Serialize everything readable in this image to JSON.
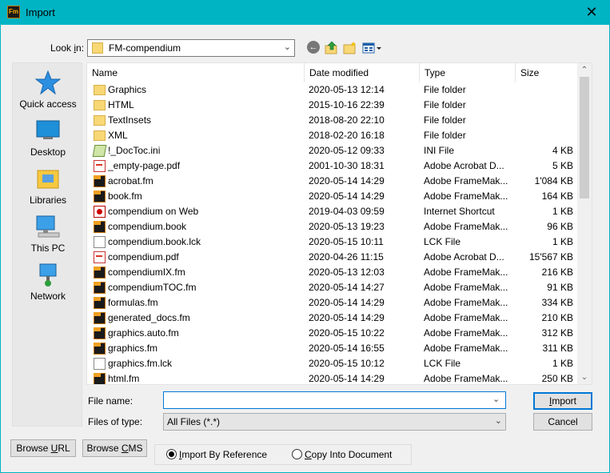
{
  "window": {
    "title": "Import",
    "app_icon": "Fm"
  },
  "lookin": {
    "label": "Look in:",
    "value": "FM-compendium"
  },
  "places": [
    {
      "label": "Quick access",
      "icon": "star-icon"
    },
    {
      "label": "Desktop",
      "icon": "desktop-icon"
    },
    {
      "label": "Libraries",
      "icon": "libraries-icon"
    },
    {
      "label": "This PC",
      "icon": "computer-icon"
    },
    {
      "label": "Network",
      "icon": "network-icon"
    }
  ],
  "columns": {
    "name": "Name",
    "date": "Date modified",
    "type": "Type",
    "size": "Size"
  },
  "files": [
    {
      "name": "Graphics",
      "date": "2020-05-13 12:14",
      "type": "File folder",
      "size": "",
      "icon": "folder"
    },
    {
      "name": "HTML",
      "date": "2015-10-16 22:39",
      "type": "File folder",
      "size": "",
      "icon": "folder"
    },
    {
      "name": "TextInsets",
      "date": "2018-08-20 22:10",
      "type": "File folder",
      "size": "",
      "icon": "folder"
    },
    {
      "name": "XML",
      "date": "2018-02-20 16:18",
      "type": "File folder",
      "size": "",
      "icon": "folder"
    },
    {
      "name": "!_DocToc.ini",
      "date": "2020-05-12 09:33",
      "type": "INI File",
      "size": "4 KB",
      "icon": "ini"
    },
    {
      "name": "_empty-page.pdf",
      "date": "2001-10-30 18:31",
      "type": "Adobe Acrobat D...",
      "size": "5 KB",
      "icon": "pdf"
    },
    {
      "name": "acrobat.fm",
      "date": "2020-05-14 14:29",
      "type": "Adobe FrameMak...",
      "size": "1'084 KB",
      "icon": "fm"
    },
    {
      "name": "book.fm",
      "date": "2020-05-14 14:29",
      "type": "Adobe FrameMak...",
      "size": "164 KB",
      "icon": "fm"
    },
    {
      "name": "compendium on Web",
      "date": "2019-04-03 09:59",
      "type": "Internet Shortcut",
      "size": "1 KB",
      "icon": "web"
    },
    {
      "name": "compendium.book",
      "date": "2020-05-13 19:23",
      "type": "Adobe FrameMak...",
      "size": "96 KB",
      "icon": "fm"
    },
    {
      "name": "compendium.book.lck",
      "date": "2020-05-15 10:11",
      "type": "LCK File",
      "size": "1 KB",
      "icon": "lck"
    },
    {
      "name": "compendium.pdf",
      "date": "2020-04-26 11:15",
      "type": "Adobe Acrobat D...",
      "size": "15'567 KB",
      "icon": "pdf"
    },
    {
      "name": "compendiumIX.fm",
      "date": "2020-05-13 12:03",
      "type": "Adobe FrameMak...",
      "size": "216 KB",
      "icon": "fm"
    },
    {
      "name": "compendiumTOC.fm",
      "date": "2020-05-14 14:27",
      "type": "Adobe FrameMak...",
      "size": "91 KB",
      "icon": "fm"
    },
    {
      "name": "formulas.fm",
      "date": "2020-05-14 14:29",
      "type": "Adobe FrameMak...",
      "size": "334 KB",
      "icon": "fm"
    },
    {
      "name": "generated_docs.fm",
      "date": "2020-05-14 14:29",
      "type": "Adobe FrameMak...",
      "size": "210 KB",
      "icon": "fm"
    },
    {
      "name": "graphics.auto.fm",
      "date": "2020-05-15 10:22",
      "type": "Adobe FrameMak...",
      "size": "312 KB",
      "icon": "fm"
    },
    {
      "name": "graphics.fm",
      "date": "2020-05-14 16:55",
      "type": "Adobe FrameMak...",
      "size": "311 KB",
      "icon": "fm"
    },
    {
      "name": "graphics.fm.lck",
      "date": "2020-05-15 10:12",
      "type": "LCK File",
      "size": "1 KB",
      "icon": "lck"
    },
    {
      "name": "html.fm",
      "date": "2020-05-14 14:29",
      "type": "Adobe FrameMak...",
      "size": "250 KB",
      "icon": "fm"
    }
  ],
  "filename": {
    "label": "File name:",
    "value": ""
  },
  "filetype": {
    "label": "Files of type:",
    "value": "All Files (*.*)"
  },
  "buttons": {
    "import": "Import",
    "cancel": "Cancel",
    "browse_url": "Browse URL",
    "browse_cms": "Browse CMS"
  },
  "options": {
    "by_reference": "Import By Reference",
    "copy_into": "Copy Into Document",
    "selected": "by_reference"
  }
}
